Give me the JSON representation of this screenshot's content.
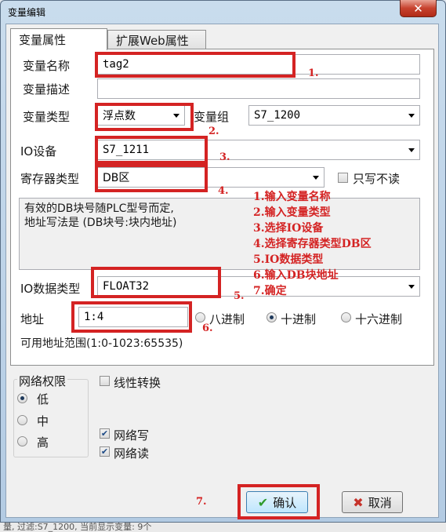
{
  "window": {
    "title": "变量编辑",
    "close_glyph": "✕"
  },
  "tabs": [
    {
      "label": "变量属性"
    },
    {
      "label": "扩展Web属性"
    }
  ],
  "form": {
    "name_label": "变量名称",
    "name_value": "tag2",
    "desc_label": "变量描述",
    "desc_value": "",
    "type_label": "变量类型",
    "type_value": "浮点数",
    "group_label": "变量组",
    "group_value": "S7_1200",
    "io_device_label": "IO设备",
    "io_device_value": "S7_1211",
    "register_label": "寄存器类型",
    "register_value": "DB区",
    "write_only_label": "只写不读",
    "description_text": "有效的DB块号随PLC型号而定,\n地址写法是 (DB块号:块内地址)",
    "io_data_type_label": "IO数据类型",
    "io_data_type_value": "FLOAT32",
    "address_label": "地址",
    "address_value": "1:4",
    "radix_options": [
      "八进制",
      "十进制",
      "十六进制"
    ],
    "radix_selected": "十进制",
    "address_range": "可用地址范围(1:0-1023:65535)",
    "network_group_label": "网络权限",
    "permission_options": [
      "低",
      "中",
      "高"
    ],
    "permission_selected": "低",
    "linear_label": "线性转换",
    "linear_checked": false,
    "net_write_label": "网络写",
    "net_write_checked": true,
    "net_read_label": "网络读",
    "net_read_checked": true
  },
  "buttons": {
    "ok": "确认",
    "cancel": "取消"
  },
  "annotations": {
    "markers": [
      "1.",
      "2.",
      "3.",
      "4.",
      "5.",
      "6.",
      "7."
    ],
    "steps": [
      "1.输入变量名称",
      "2.输入变量类型",
      "3.选择IO设备",
      "4.选择寄存器类型DB区",
      "5.IO数据类型",
      "6.输入DB块地址",
      "7.确定"
    ],
    "color": "#d42323"
  },
  "background_status": "量, 过滤:S7_1200, 当前显示变量: 9个"
}
